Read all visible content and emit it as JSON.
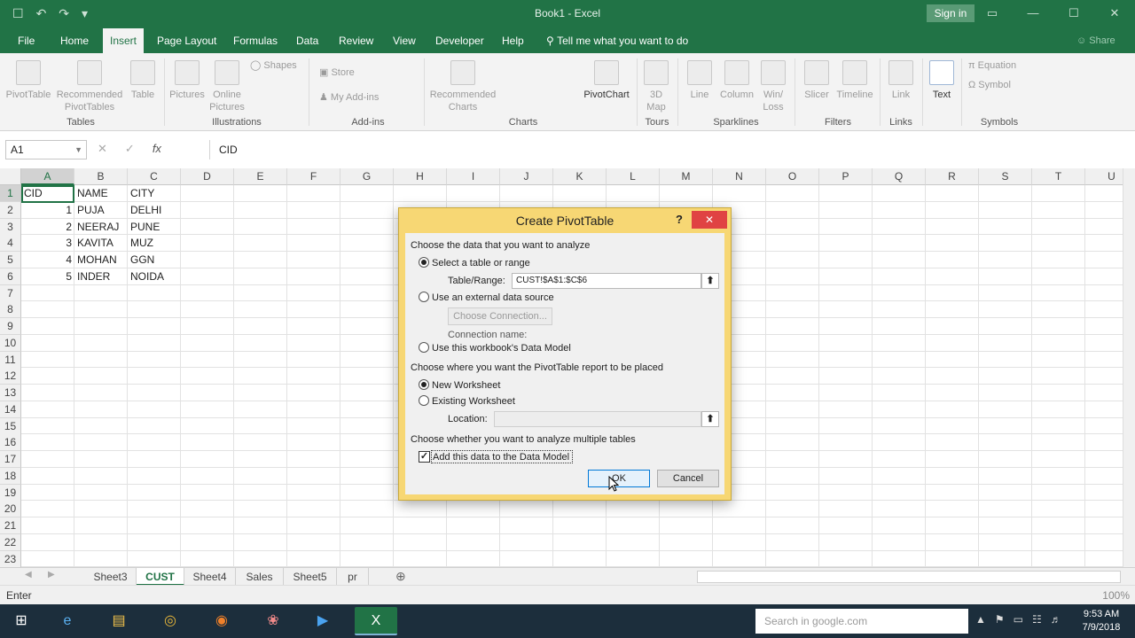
{
  "window": {
    "title": "Book1  -  Excel",
    "sign_in": "Sign in",
    "qat": [
      "☐",
      "↶",
      "↷",
      "▾"
    ],
    "controls": [
      "▭",
      "—",
      "☐",
      "✕"
    ]
  },
  "ribbon_tabs": {
    "items": [
      "File",
      "Home",
      "Insert",
      "Page Layout",
      "Formulas",
      "Data",
      "Review",
      "View",
      "Developer",
      "Help"
    ],
    "active": "Insert",
    "tell_me": "Tell me what you want to do",
    "share": "Share"
  },
  "ribbon": {
    "pivottable": "PivotTable",
    "recommended_pivottables": [
      "Recommended",
      "PivotTables"
    ],
    "table": "Table",
    "pictures": "Pictures",
    "online_pictures": [
      "Online",
      "Pictures"
    ],
    "shapes": "Shapes",
    "store": "Store",
    "my_addins": "My Add-ins",
    "recommended_charts": [
      "Recommended",
      "Charts"
    ],
    "pivotchart": "PivotChart",
    "map_3d": [
      "3D",
      "Map"
    ],
    "line": "Line",
    "column": "Column",
    "winloss": [
      "Win/",
      "Loss"
    ],
    "slicer": "Slicer",
    "timeline": "Timeline",
    "link": "Link",
    "text": "Text",
    "equation": "Equation",
    "symbol": "Symbol",
    "groups": [
      "Tables",
      "Illustrations",
      "Add-ins",
      "Charts",
      "Tours",
      "Sparklines",
      "Filters",
      "Links",
      "Symbols"
    ]
  },
  "formula_bar": {
    "name_box": "A1",
    "icons": [
      "✕",
      "✓",
      "fx"
    ],
    "content": "CID"
  },
  "grid": {
    "columns": [
      "A",
      "B",
      "C",
      "D",
      "E",
      "F",
      "G",
      "H",
      "I",
      "J",
      "K",
      "L",
      "M",
      "N",
      "O",
      "P",
      "Q",
      "R",
      "S",
      "T",
      "U"
    ],
    "rows": [
      "1",
      "2",
      "3",
      "4",
      "5",
      "6",
      "7",
      "8",
      "9",
      "10",
      "11",
      "12",
      "13",
      "14",
      "15",
      "16",
      "17",
      "18",
      "19",
      "20",
      "21",
      "22",
      "23"
    ],
    "data": [
      [
        "CID",
        "NAME",
        "CITY"
      ],
      [
        "1",
        "PUJA",
        "DELHI"
      ],
      [
        "2",
        "NEERAJ",
        "PUNE"
      ],
      [
        "3",
        "KAVITA",
        "MUZ"
      ],
      [
        "4",
        "MOHAN",
        "GGN"
      ],
      [
        "5",
        "INDER",
        "NOIDA"
      ]
    ]
  },
  "sheets": {
    "items": [
      "Sheet3",
      "CUST",
      "Sheet4",
      "Sales",
      "Sheet5",
      "pr"
    ],
    "active": "CUST",
    "add": "⊕"
  },
  "status": {
    "mode": "Enter",
    "zoom": "100%"
  },
  "dialog": {
    "title": "Create PivotTable",
    "help": "?",
    "close": "✕",
    "section_data": "Choose the data that you want to analyze",
    "opt_table_range": "Select a table or range",
    "table_range_label": "Table/Range:",
    "table_range_value": "CUST!$A$1:$C$6",
    "opt_external": "Use an external data source",
    "choose_connection": "Choose Connection...",
    "connection_name_label": "Connection name:",
    "opt_data_model": "Use this workbook's Data Model",
    "section_place": "Choose where you want the PivotTable report to be placed",
    "opt_new_ws": "New Worksheet",
    "opt_existing_ws": "Existing Worksheet",
    "location_label": "Location:",
    "location_value": "",
    "section_multi": "Choose whether you want to analyze multiple tables",
    "add_data_model": "Add this data to the Data Model",
    "ok": "OK",
    "cancel": "Cancel"
  },
  "taskbar": {
    "search_placeholder": "Search in google.com",
    "time": "9:53 AM",
    "date": "7/9/2018",
    "apps": [
      "start-icon",
      "internet-explorer-icon",
      "file-explorer-icon",
      "chrome-icon",
      "firefox-icon",
      "app-icon",
      "zoom-icon",
      "excel-icon"
    ]
  },
  "colors": {
    "excel_green": "#217346",
    "dialog_border": "#f7d774",
    "close_red": "#e04343"
  }
}
